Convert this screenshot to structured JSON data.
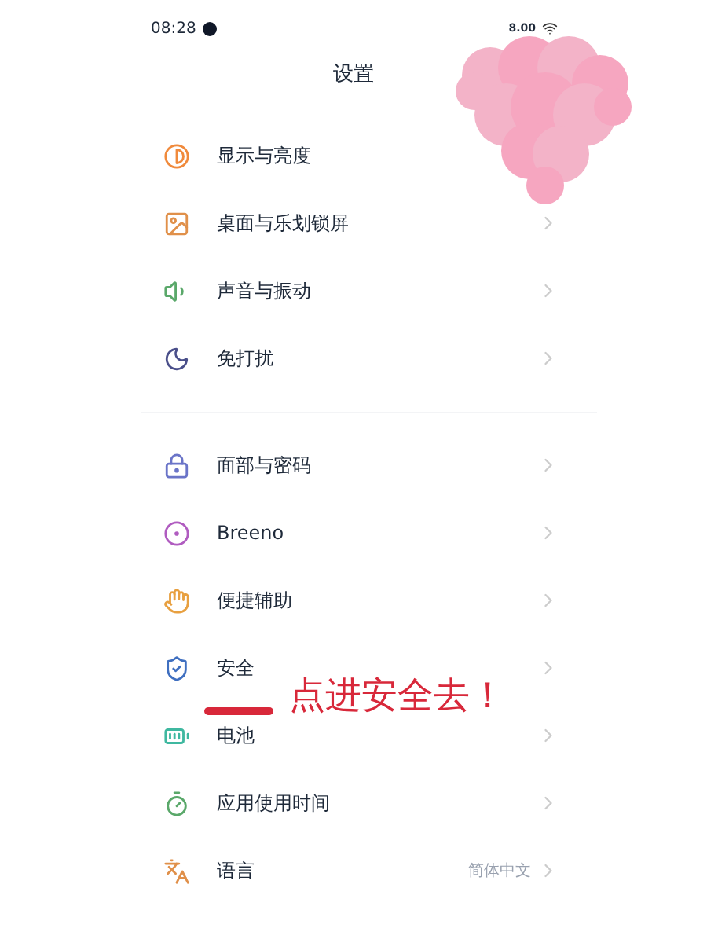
{
  "status_bar": {
    "time": "08:28",
    "speed": "8.00"
  },
  "title": "设置",
  "groups": [
    {
      "items": [
        {
          "label": "显示与亮度",
          "chevron": false
        },
        {
          "label": "桌面与乐划锁屏",
          "chevron": true
        },
        {
          "label": "声音与振动",
          "chevron": true
        },
        {
          "label": "免打扰",
          "chevron": true
        }
      ]
    },
    {
      "items": [
        {
          "label": "面部与密码",
          "chevron": true
        },
        {
          "label": "Breeno",
          "chevron": true
        },
        {
          "label": "便捷辅助",
          "chevron": true
        },
        {
          "label": "安全",
          "chevron": true
        },
        {
          "label": "电池",
          "chevron": true
        },
        {
          "label": "应用使用时间",
          "chevron": true
        },
        {
          "label": "语言",
          "value": "简体中文",
          "chevron": true
        }
      ]
    }
  ],
  "annotation": {
    "text": "点进安全去！"
  }
}
